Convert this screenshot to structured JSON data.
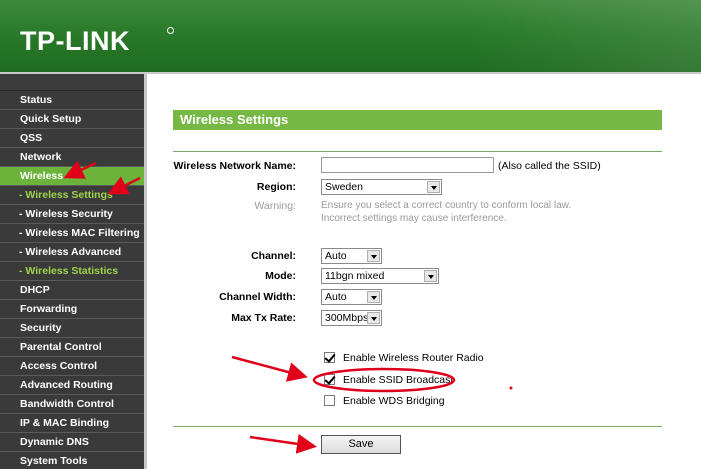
{
  "header": {
    "logo": "TP-LINK",
    "colors": {
      "brand_green": "#2a7a2a",
      "accent_green": "#76b844",
      "annotation_red": "#e0001a"
    }
  },
  "sidebar": {
    "items": [
      {
        "label": "Status"
      },
      {
        "label": "Quick Setup"
      },
      {
        "label": "QSS"
      },
      {
        "label": "Network"
      },
      {
        "label": "Wireless"
      },
      {
        "label": "- Wireless Settings"
      },
      {
        "label": "- Wireless Security"
      },
      {
        "label": "- Wireless MAC Filtering"
      },
      {
        "label": "- Wireless Advanced"
      },
      {
        "label": "- Wireless Statistics"
      },
      {
        "label": "DHCP"
      },
      {
        "label": "Forwarding"
      },
      {
        "label": "Security"
      },
      {
        "label": "Parental Control"
      },
      {
        "label": "Access Control"
      },
      {
        "label": "Advanced Routing"
      },
      {
        "label": "Bandwidth Control"
      },
      {
        "label": "IP & MAC Binding"
      },
      {
        "label": "Dynamic DNS"
      },
      {
        "label": "System Tools"
      }
    ]
  },
  "main": {
    "section_title": "Wireless Settings",
    "fields": {
      "ssid_label": "Wireless Network Name:",
      "ssid_value": "",
      "ssid_hint": "(Also called the SSID)",
      "region_label": "Region:",
      "region_value": "Sweden",
      "warning_label": "Warning:",
      "warning_line1": "Ensure you select a correct country to conform local law.",
      "warning_line2": "Incorrect settings may cause interference.",
      "channel_label": "Channel:",
      "channel_value": "Auto",
      "mode_label": "Mode:",
      "mode_value": "11bgn mixed",
      "width_label": "Channel Width:",
      "width_value": "Auto",
      "txrate_label": "Max Tx Rate:",
      "txrate_value": "300Mbps"
    },
    "checkboxes": {
      "radio": {
        "label": "Enable Wireless Router Radio",
        "checked": true
      },
      "ssid_broadcast": {
        "label": "Enable SSID Broadcast",
        "checked": true
      },
      "wds": {
        "label": "Enable WDS Bridging",
        "checked": false
      }
    },
    "save_label": "Save"
  }
}
